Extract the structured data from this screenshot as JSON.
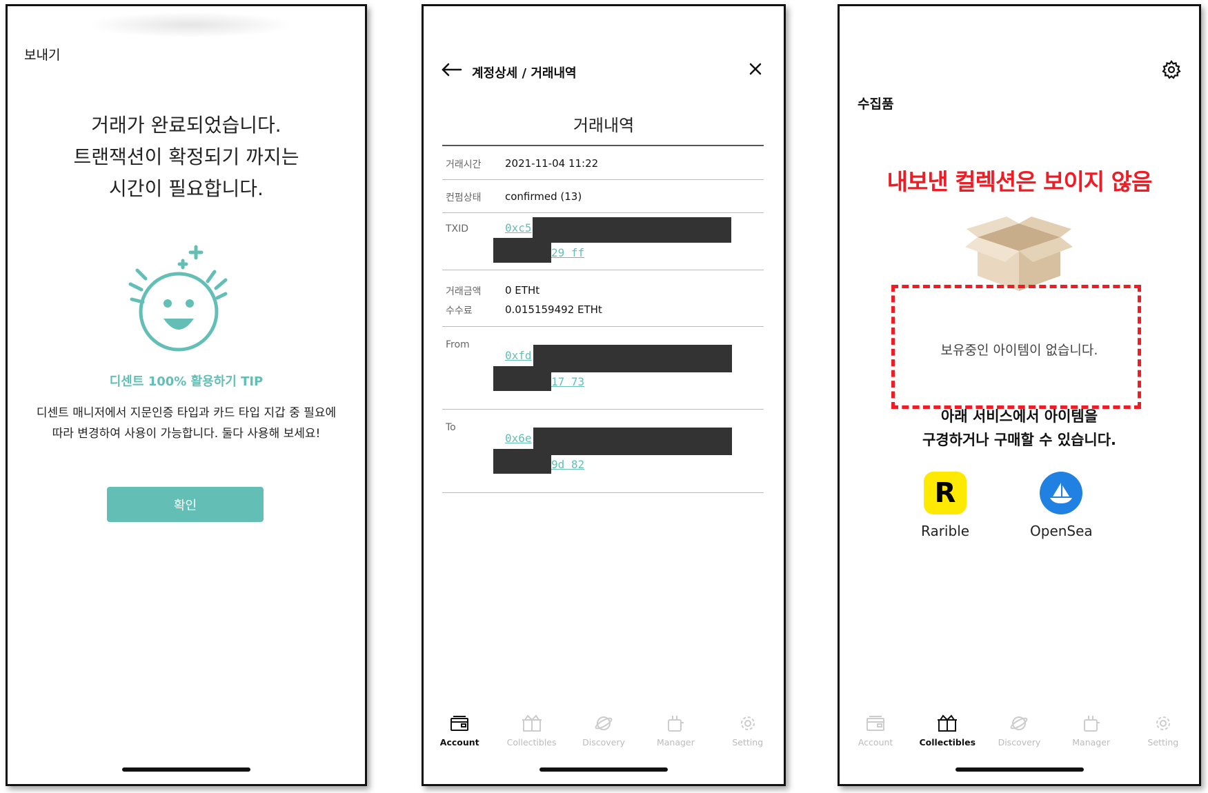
{
  "screen1": {
    "header": "보내기",
    "message_lines": [
      "거래가 완료되었습니다.",
      "트랜잭션이 확정되기 까지는",
      "시간이 필요합니다."
    ],
    "tip_title": "디센트 100% 활용하기 TIP",
    "tip_lines": [
      "디센트 매니저에서 지문인증 타입과 카드 타입 지갑 중 필요에",
      "따라 변경하여 사용이 가능합니다. 둘다 사용해 보세요!"
    ],
    "confirm_label": "확인",
    "accent_color": "#63bfb6"
  },
  "screen2": {
    "breadcrumb": "계정상세 / 거래내역",
    "title": "거래내역",
    "rows": {
      "time_label": "거래시간",
      "time_value": "2021-11-04 11:22",
      "status_label": "컨펌상태",
      "status_value": "confirmed (13)",
      "txid_label": "TXID",
      "txid_start": "0xc5",
      "txid_end": "29 ff",
      "amount_label": "거래금액",
      "amount_value": "0 ETHt",
      "fee_label": "수수료",
      "fee_value": "0.015159492 ETHt",
      "from_label": "From",
      "from_start": "0xfd",
      "from_end": "17 73",
      "to_label": "To",
      "to_start": "0x6e",
      "to_end": "9d 82"
    }
  },
  "screen3": {
    "header": "수집품",
    "annotation": "내보낸 컬렉션은 보이지 않음",
    "empty_text": "보유중인 아이템이 없습니다.",
    "sub_lines": [
      "아래 서비스에서 아이템을",
      "구경하거나 구매할 수 있습니다."
    ],
    "services": [
      {
        "name": "Rarible",
        "icon": "rarible-logo-icon",
        "color": "#fee902"
      },
      {
        "name": "OpenSea",
        "icon": "opensea-logo-icon",
        "color": "#2081e2"
      }
    ],
    "annotation_color": "#ee1c24"
  },
  "tabs": {
    "labels": [
      "Account",
      "Collectibles",
      "Discovery",
      "Manager",
      "Setting"
    ],
    "icons": [
      "wallet-icon",
      "gift-box-icon",
      "planet-icon",
      "manager-icon",
      "gear-icon"
    ],
    "screen2_active": "Account",
    "screen3_active": "Collectibles"
  }
}
